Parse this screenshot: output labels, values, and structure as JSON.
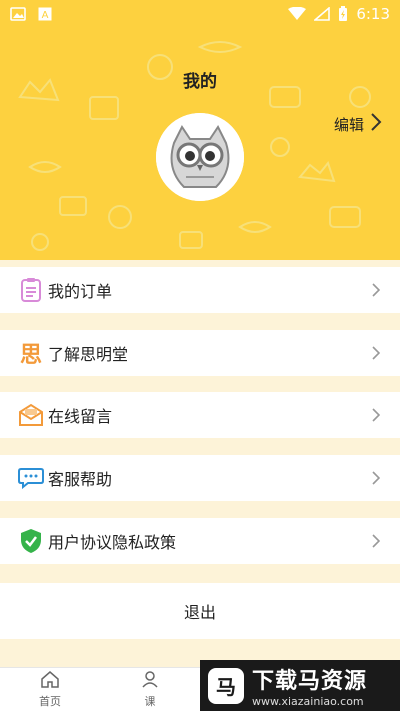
{
  "status_bar": {
    "time": "6:13",
    "icons": [
      "image-icon",
      "a-icon",
      "wifi-icon",
      "signal-icon",
      "battery-icon"
    ]
  },
  "header": {
    "title": "我的",
    "edit_label": "编辑",
    "bg_color": "#fdd13f"
  },
  "menu": {
    "items": [
      {
        "label": "我的订单",
        "icon": "order-list-icon"
      },
      {
        "label": "了解思明堂",
        "icon": "si-character-icon",
        "icon_text": "思"
      },
      {
        "label": "在线留言",
        "icon": "envelope-icon"
      },
      {
        "label": "客服帮助",
        "icon": "chat-bubble-icon"
      },
      {
        "label": "用户协议隐私政策",
        "icon": "shield-check-icon"
      }
    ]
  },
  "logout": {
    "label": "退出"
  },
  "tabbar": {
    "tabs": [
      {
        "label": "首页",
        "icon": "home-icon"
      },
      {
        "label": "课",
        "icon": "person-icon"
      }
    ]
  },
  "watermark": {
    "logo_char": "马",
    "title": "下载马资源",
    "url": "www.xiazainiao.com"
  }
}
